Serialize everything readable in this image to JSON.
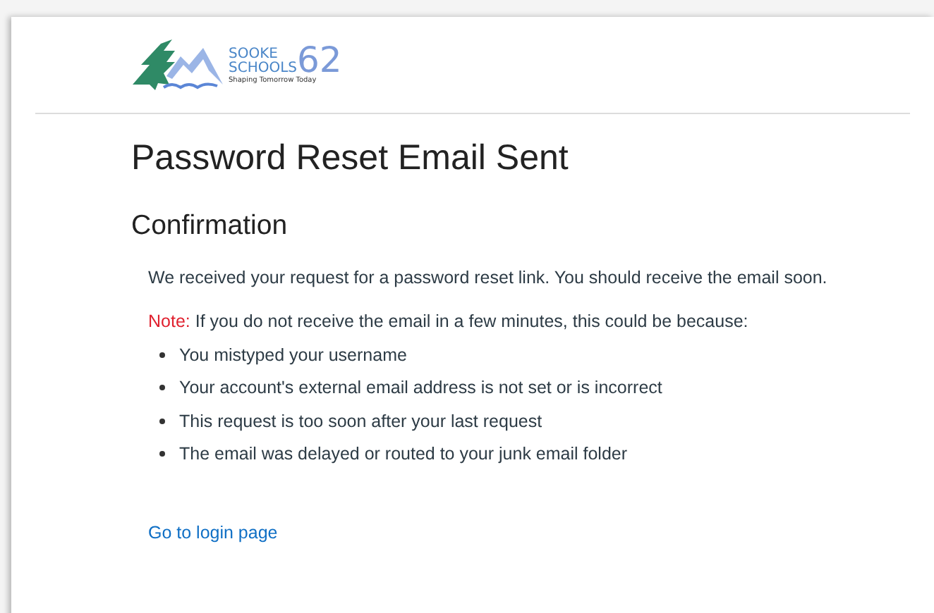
{
  "logo": {
    "line_1": "SOOKE",
    "line_2": "SCHOOLS",
    "number": "62",
    "tagline": "Shaping Tomorrow Today"
  },
  "title": "Password Reset Email Sent",
  "section": {
    "heading": "Confirmation",
    "message": "We received your request for a password reset link. You should receive the email soon.",
    "note_label": "Note:",
    "note_text": "If you do not receive the email in a few minutes, this could be because:",
    "reasons": [
      "You mistyped your username",
      "Your account's external email address is not set or is incorrect",
      "This request is too soon after your last request",
      "The email was delayed or routed to your junk email folder"
    ]
  },
  "link": "Go to login page"
}
